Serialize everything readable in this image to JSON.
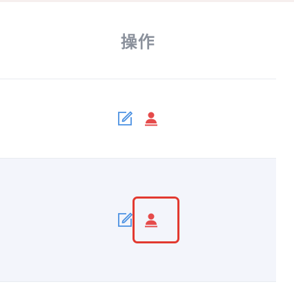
{
  "table": {
    "column_header": "操作",
    "rows": [
      {
        "actions": [
          {
            "icon": "edit-icon",
            "color": "#4a90e2"
          },
          {
            "icon": "user-icon",
            "color": "#e54b4b"
          }
        ]
      },
      {
        "actions": [
          {
            "icon": "edit-icon",
            "color": "#4a90e2"
          },
          {
            "icon": "user-icon",
            "color": "#e54b4b"
          }
        ]
      }
    ]
  },
  "colors": {
    "edit": "#4a90e2",
    "user": "#e54b4b",
    "highlight": "#e2392f",
    "row_alt_bg": "#f3f5fb"
  }
}
